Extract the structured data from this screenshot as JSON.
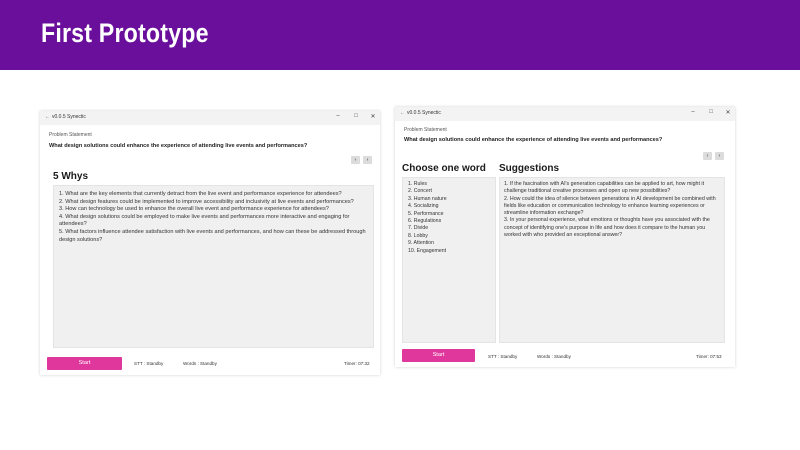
{
  "slide": {
    "title": "First Prototype",
    "banner_color": "#6a0f9b",
    "accent_color": "#e0379c"
  },
  "windows": [
    {
      "titlebar": {
        "title": "v0.0.5 Synectic",
        "minimize": "–",
        "maximize": "□",
        "close": "✕"
      },
      "problem_label": "Problem Statement",
      "problem": "What design solutions could enhance the experience of attending live events and performances?",
      "nav": {
        "prev": "‹",
        "next": "›"
      },
      "section_title": "5 Whys",
      "whys": [
        "1. What are the key elements that currently detract from the live event and performance experience for attendees?",
        "2. What design features could be implemented to improve accessibility and inclusivity at live events and performances?",
        "3. How can technology be used to enhance the overall live event and performance experience for attendees?",
        "4. What design solutions could be employed to make live events and performances more interactive and engaging for attendees?",
        "5. What factors influence attendee satisfaction with live events and performances, and how can these be addressed through design solutions?"
      ],
      "start_label": "Start",
      "stt_status": "STT : Standby",
      "words_status": "Words : Standby",
      "timer": "Timer: 07:32"
    },
    {
      "titlebar": {
        "title": "v0.0.5 Synectic",
        "minimize": "–",
        "maximize": "□",
        "close": "✕"
      },
      "problem_label": "Problem Statement",
      "problem": "What design solutions could enhance the experience of attending live events and performances?",
      "nav": {
        "prev": "‹",
        "next": "›"
      },
      "choose_title": "Choose one word",
      "suggestions_title": "Suggestions",
      "words": [
        "1. Rules",
        "2. Concert",
        "3. Human nature",
        "4. Socializing",
        "5. Performance",
        "6. Regulations",
        "7. Divide",
        "8. Lobby",
        "9. Attention",
        "10. Engagement"
      ],
      "suggestions": [
        "1. If the fascination with AI's generation capabilities can be applied to art, how might it challenge traditional creative processes and open up new possibilities?",
        "2. How could the idea of silence between generations in AI development be combined with fields like education or communication technology to enhance learning experiences or streamline information exchange?",
        "3. In your personal experience, what emotions or thoughts have you associated with the concept of identifying one's purpose in life and how does it compare to the human you worked with who provided an exceptional answer?"
      ],
      "start_label": "Start",
      "stt_status": "STT : Standby",
      "words_status": "Words : Standby",
      "timer": "Timer: 07:53"
    }
  ]
}
